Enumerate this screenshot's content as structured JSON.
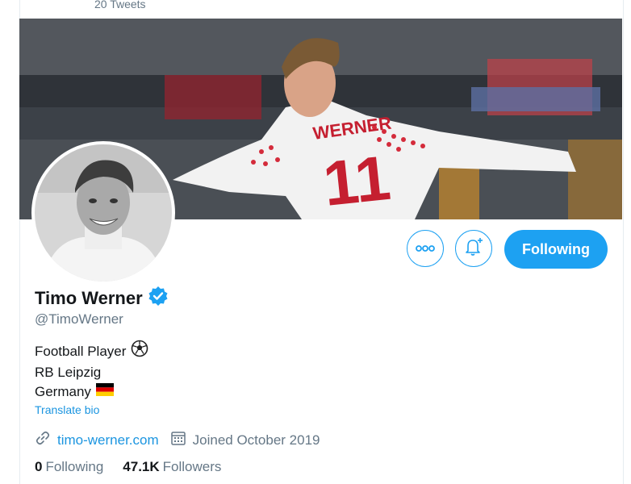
{
  "header": {
    "tweets_count": "20 Tweets"
  },
  "profile": {
    "name": "Timo Werner",
    "handle": "@TimoWerner",
    "verified": true,
    "bio_lines": [
      "Football Player",
      "RB Leipzig",
      "Germany"
    ],
    "translate_label": "Translate bio",
    "website": "timo-werner.com",
    "joined": "Joined October 2019",
    "banner_jersey_name": "WERNER",
    "banner_jersey_number": "11"
  },
  "stats": {
    "following_count": "0",
    "following_label": "Following",
    "followers_count": "47.1K",
    "followers_label": "Followers"
  },
  "actions": {
    "follow_label": "Following"
  },
  "colors": {
    "accent": "#1da1f2",
    "link": "#1b95e0",
    "secondary_text": "#657786",
    "primary_text": "#14171a"
  },
  "icons": {
    "more": "more-icon",
    "notify": "bell-plus-icon",
    "verified": "verified-badge-icon",
    "link": "link-icon",
    "calendar": "calendar-icon",
    "soccer": "soccer-ball-icon",
    "flag": "germany-flag-icon"
  }
}
